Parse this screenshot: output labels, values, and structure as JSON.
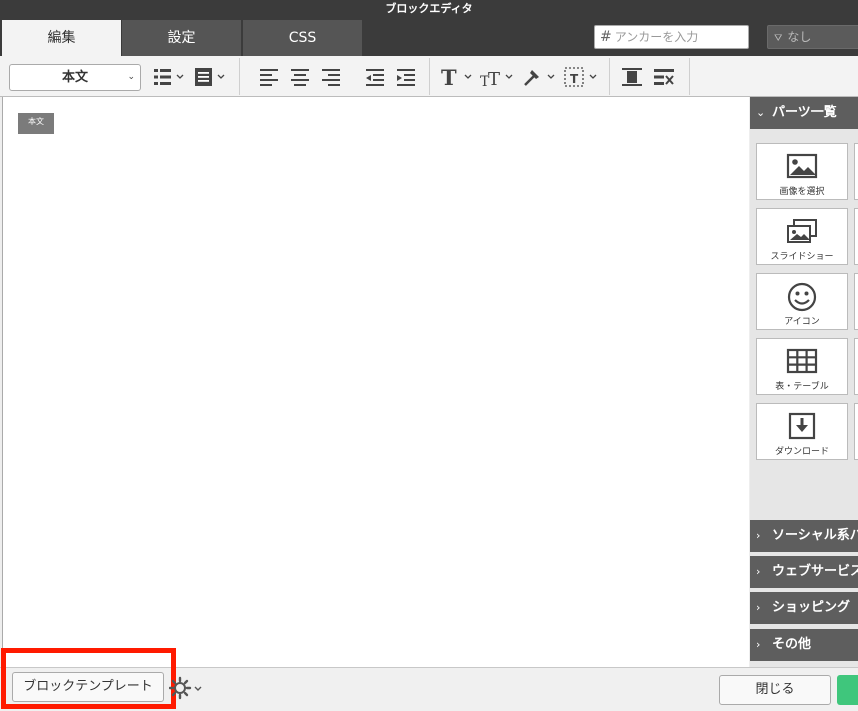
{
  "window": {
    "title": "ブロックエディタ"
  },
  "tabs": [
    {
      "label": "編集",
      "active": true
    },
    {
      "label": "設定",
      "active": false
    },
    {
      "label": "CSS",
      "active": false
    }
  ],
  "anchor": {
    "placeholder": "アンカーを入力",
    "icon": "hash-icon"
  },
  "style_select": {
    "value": "なし"
  },
  "toolbar": {
    "block_style": "本文"
  },
  "editor": {
    "block_badge": "本文"
  },
  "sidebar": {
    "parts_header": "パーツ一覧",
    "parts": [
      {
        "label": "画像を選択",
        "icon": "image-icon"
      },
      {
        "label": "スライドショー",
        "icon": "slideshow-icon"
      },
      {
        "label": "アイコン",
        "icon": "smiley-icon"
      },
      {
        "label": "表・テーブル",
        "icon": "table-icon"
      },
      {
        "label": "ダウンロード",
        "icon": "download-icon"
      }
    ],
    "sections": [
      {
        "label": "ソーシャル系パーツ"
      },
      {
        "label": "ウェブサービス"
      },
      {
        "label": "ショッピング"
      },
      {
        "label": "その他"
      }
    ]
  },
  "footer": {
    "template_button": "ブロックテンプレート",
    "close_button": "閉じる"
  },
  "colors": {
    "accent_green": "#3fc67c",
    "highlight_red": "#ff1a00",
    "dark_bar": "#3b3b3b"
  }
}
